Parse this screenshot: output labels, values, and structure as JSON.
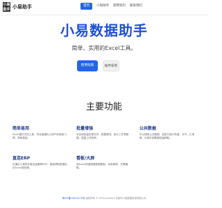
{
  "header": {
    "logo_text": "小易\n助手",
    "brand": "小易助手",
    "nav": [
      {
        "label": "首页",
        "active": true
      },
      {
        "label": "小易助手",
        "active": false
      },
      {
        "label": "使用指引",
        "active": false
      },
      {
        "label": "联系我们",
        "active": false
      }
    ]
  },
  "hero": {
    "title": "小易数据助手",
    "subtitle": "简单、实用的Excel工具。",
    "primary_button": "使用指南",
    "secondary_button": "插件安装"
  },
  "features": {
    "title": "主要功能",
    "items": [
      {
        "title": "简单易用",
        "desc": "Excel插件式的工具，符合普通办公用户的使用习惯，简单易用。"
      },
      {
        "title": "批量增强",
        "desc": "可实现批量处理文件、数据清洗、统计工作表数据，提高工作效率。"
      },
      {
        "title": "公共数据",
        "desc": "可以调用公共数据，如官方统计年鉴，天气、汇率等，实现外部数据批量获取。"
      },
      {
        "title": "直连ERP",
        "desc": "可通过小易助手直连金蝶等ERP，直接获取数据后在Excel里处理。"
      },
      {
        "title": "看板/大屏",
        "desc": "用Excel快速搭建数据看板，动态刷新，无需编程。"
      }
    ]
  },
  "footer": {
    "icp": "粤ICP备19025275号",
    "text": "版权所有 © 2019-present 东莞市小易数据科技有限公司"
  },
  "colors": {
    "accent": "#2563eb",
    "title": "#1e4fd8"
  }
}
